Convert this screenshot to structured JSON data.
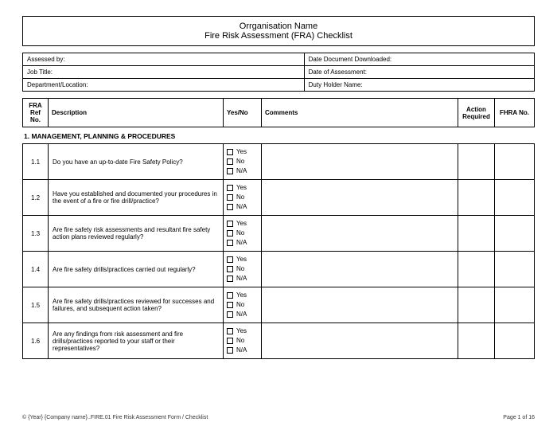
{
  "title": {
    "line1": "Orrganisation Name",
    "line2": "Fire Risk Assessment (FRA) Checklist"
  },
  "info": {
    "assessed_by": "Assessed by:",
    "date_downloaded": "Date Document Downloaded:",
    "job_title": "Job Title:",
    "date_assessment": "Date of Assessment:",
    "dept": "Department/Location:",
    "duty_holder": "Duty Holder Name:"
  },
  "headers": {
    "ref": "FRA Ref No.",
    "desc": "Description",
    "yn": "Yes/No",
    "comments": "Comments",
    "action": "Action Required",
    "fhra": "FHRA No."
  },
  "section": "1. MANAGEMENT, PLANNING & PROCEDURES",
  "yn_opts": {
    "yes": "Yes",
    "no": "No",
    "na": "N/A"
  },
  "rows": [
    {
      "ref": "1.1",
      "desc": "Do you have an up-to-date Fire Safety Policy?"
    },
    {
      "ref": "1.2",
      "desc": "Have you established and documented your procedures in the event of a fire or fire drill/practice?"
    },
    {
      "ref": "1.3",
      "desc": "Are fire safety risk assessments and resultant fire safety action plans reviewed regularly?"
    },
    {
      "ref": "1.4",
      "desc": "Are fire safety drills/practices carried out regularly?"
    },
    {
      "ref": "1.5",
      "desc": "Are fire safety drills/practices reviewed for successes and failures, and subsequent action taken?"
    },
    {
      "ref": "1.6",
      "desc": "Are any findings from risk assessment and fire drills/practices reported to your staff or their representatives?"
    }
  ],
  "footer": {
    "left": "© {Year} {Company name}..FIRE.01 Fire Risk Assessment Form / Checklist",
    "right": "Page 1 of 16"
  }
}
